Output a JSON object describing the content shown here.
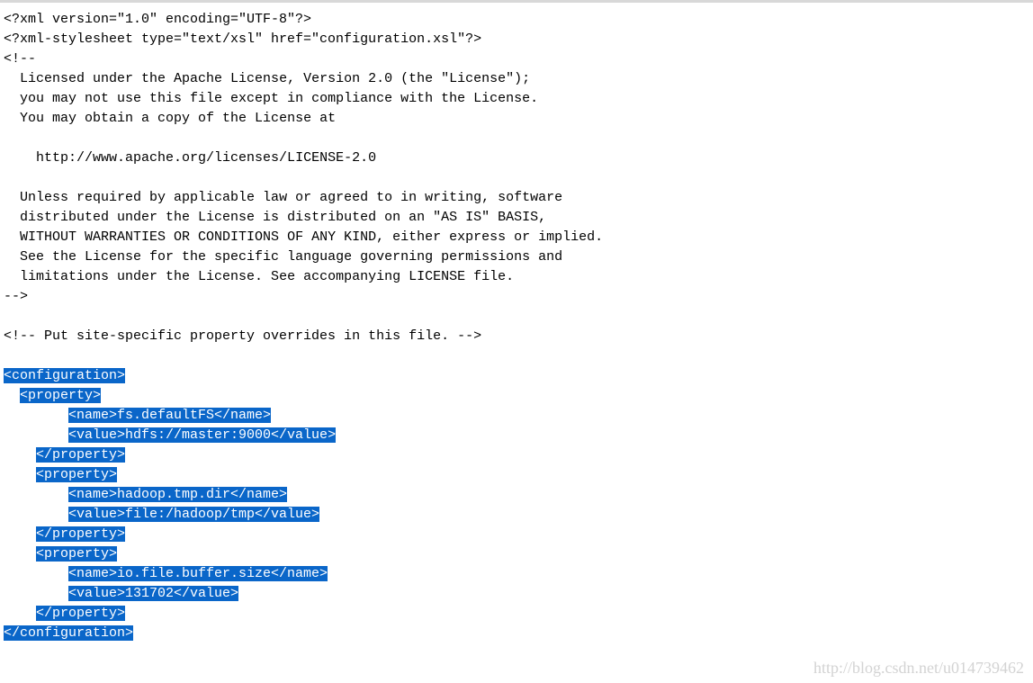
{
  "lines": [
    {
      "pre": "",
      "text": "<?xml version=\"1.0\" encoding=\"UTF-8\"?>",
      "sel": false
    },
    {
      "pre": "",
      "text": "<?xml-stylesheet type=\"text/xsl\" href=\"configuration.xsl\"?>",
      "sel": false
    },
    {
      "pre": "",
      "text": "<!--",
      "sel": false
    },
    {
      "pre": "  ",
      "text": "Licensed under the Apache License, Version 2.0 (the \"License\");",
      "sel": false
    },
    {
      "pre": "  ",
      "text": "you may not use this file except in compliance with the License.",
      "sel": false
    },
    {
      "pre": "  ",
      "text": "You may obtain a copy of the License at",
      "sel": false
    },
    {
      "pre": "",
      "text": "",
      "sel": false
    },
    {
      "pre": "    ",
      "text": "http://www.apache.org/licenses/LICENSE-2.0",
      "sel": false
    },
    {
      "pre": "",
      "text": "",
      "sel": false
    },
    {
      "pre": "  ",
      "text": "Unless required by applicable law or agreed to in writing, software",
      "sel": false
    },
    {
      "pre": "  ",
      "text": "distributed under the License is distributed on an \"AS IS\" BASIS,",
      "sel": false
    },
    {
      "pre": "  ",
      "text": "WITHOUT WARRANTIES OR CONDITIONS OF ANY KIND, either express or implied.",
      "sel": false
    },
    {
      "pre": "  ",
      "text": "See the License for the specific language governing permissions and",
      "sel": false
    },
    {
      "pre": "  ",
      "text": "limitations under the License. See accompanying LICENSE file.",
      "sel": false
    },
    {
      "pre": "",
      "text": "-->",
      "sel": false
    },
    {
      "pre": "",
      "text": "",
      "sel": false
    },
    {
      "pre": "",
      "text": "<!-- Put site-specific property overrides in this file. -->",
      "sel": false
    },
    {
      "pre": "",
      "text": "",
      "sel": false
    },
    {
      "pre": "",
      "text": "<configuration>",
      "sel": true
    },
    {
      "pre": "  ",
      "text": "<property>",
      "sel": true
    },
    {
      "pre": "        ",
      "text": "<name>fs.defaultFS</name>",
      "sel": true
    },
    {
      "pre": "        ",
      "text": "<value>hdfs://master:9000</value>",
      "sel": true
    },
    {
      "pre": "    ",
      "text": "</property>",
      "sel": true
    },
    {
      "pre": "    ",
      "text": "<property>",
      "sel": true
    },
    {
      "pre": "        ",
      "text": "<name>hadoop.tmp.dir</name>",
      "sel": true
    },
    {
      "pre": "        ",
      "text": "<value>file:/hadoop/tmp</value>",
      "sel": true
    },
    {
      "pre": "    ",
      "text": "</property>",
      "sel": true
    },
    {
      "pre": "    ",
      "text": "<property>",
      "sel": true
    },
    {
      "pre": "        ",
      "text": "<name>io.file.buffer.size</name>",
      "sel": true
    },
    {
      "pre": "        ",
      "text": "<value>131702</value>",
      "sel": true
    },
    {
      "pre": "    ",
      "text": "</property>",
      "sel": true
    },
    {
      "pre": "",
      "text": "</configuration>",
      "sel": true
    }
  ],
  "watermark": "http://blog.csdn.net/u014739462"
}
